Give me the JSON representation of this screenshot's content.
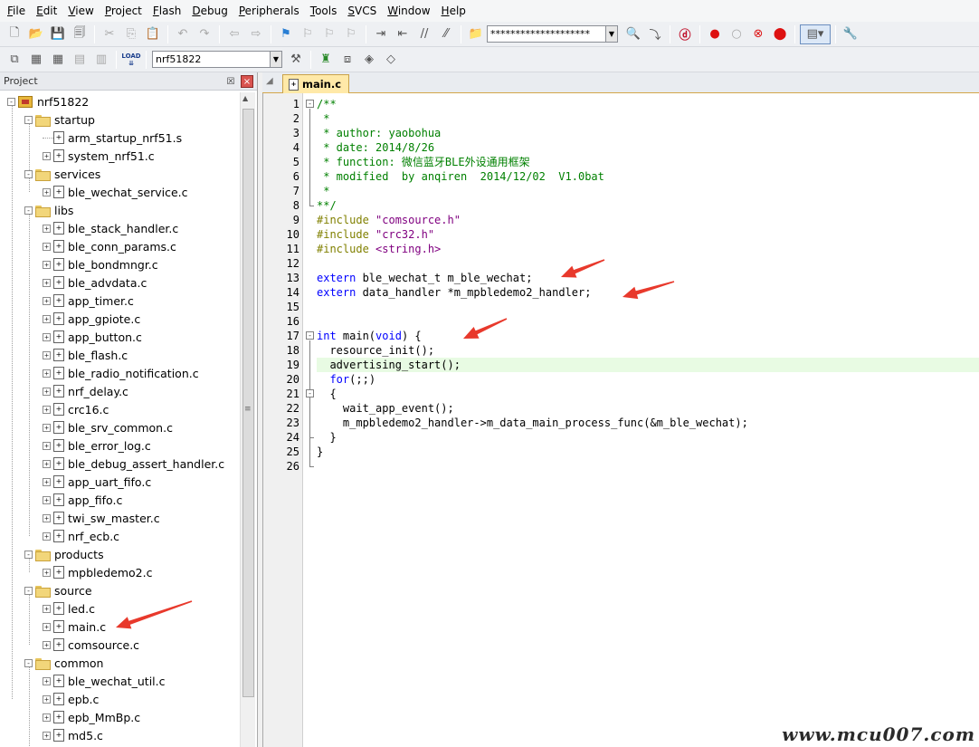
{
  "menubar": {
    "items": [
      {
        "label": "File",
        "key": "F",
        "rest": "ile"
      },
      {
        "label": "Edit",
        "key": "E",
        "rest": "dit"
      },
      {
        "label": "View",
        "key": "V",
        "rest": "iew"
      },
      {
        "label": "Project",
        "key": "P",
        "rest": "roject"
      },
      {
        "label": "Flash",
        "key": "F",
        "rest": "lash"
      },
      {
        "label": "Debug",
        "key": "D",
        "rest": "ebug"
      },
      {
        "label": "Peripherals",
        "key": "P",
        "rest": "eripherals"
      },
      {
        "label": "Tools",
        "key": "T",
        "rest": "ools"
      },
      {
        "label": "SVCS",
        "key": "S",
        "rest": "VCS"
      },
      {
        "label": "Window",
        "key": "W",
        "rest": "indow"
      },
      {
        "label": "Help",
        "key": "H",
        "rest": "elp"
      }
    ]
  },
  "toolbar": {
    "search_value": "********************",
    "target_value": "nrf51822",
    "build_icon_text": "LOAD"
  },
  "project_panel": {
    "title": "Project",
    "pin_glyph": "☒",
    "close_glyph": "×",
    "root": "nrf51822",
    "groups": [
      {
        "name": "startup",
        "files": [
          {
            "name": "arm_startup_nrf51.s",
            "expandable": false
          },
          {
            "name": "system_nrf51.c",
            "expandable": true
          }
        ]
      },
      {
        "name": "services",
        "files": [
          {
            "name": "ble_wechat_service.c",
            "expandable": true
          }
        ]
      },
      {
        "name": "libs",
        "files": [
          {
            "name": "ble_stack_handler.c",
            "expandable": true
          },
          {
            "name": "ble_conn_params.c",
            "expandable": true
          },
          {
            "name": "ble_bondmngr.c",
            "expandable": true
          },
          {
            "name": "ble_advdata.c",
            "expandable": true
          },
          {
            "name": "app_timer.c",
            "expandable": true
          },
          {
            "name": "app_gpiote.c",
            "expandable": true
          },
          {
            "name": "app_button.c",
            "expandable": true
          },
          {
            "name": "ble_flash.c",
            "expandable": true
          },
          {
            "name": "ble_radio_notification.c",
            "expandable": true
          },
          {
            "name": "nrf_delay.c",
            "expandable": true
          },
          {
            "name": "crc16.c",
            "expandable": true
          },
          {
            "name": "ble_srv_common.c",
            "expandable": true
          },
          {
            "name": "ble_error_log.c",
            "expandable": true
          },
          {
            "name": "ble_debug_assert_handler.c",
            "expandable": true
          },
          {
            "name": "app_uart_fifo.c",
            "expandable": true
          },
          {
            "name": "app_fifo.c",
            "expandable": true
          },
          {
            "name": "twi_sw_master.c",
            "expandable": true
          },
          {
            "name": "nrf_ecb.c",
            "expandable": true
          }
        ]
      },
      {
        "name": "products",
        "files": [
          {
            "name": "mpbledemo2.c",
            "expandable": true
          }
        ]
      },
      {
        "name": "source",
        "files": [
          {
            "name": "led.c",
            "expandable": true
          },
          {
            "name": "main.c",
            "expandable": true
          },
          {
            "name": "comsource.c",
            "expandable": true
          }
        ]
      },
      {
        "name": "common",
        "files": [
          {
            "name": "ble_wechat_util.c",
            "expandable": true
          },
          {
            "name": "epb.c",
            "expandable": true
          },
          {
            "name": "epb_MmBp.c",
            "expandable": true
          },
          {
            "name": "md5.c",
            "expandable": true
          }
        ]
      }
    ]
  },
  "editor": {
    "tab_label": "main.c",
    "lines": [
      {
        "n": "1",
        "tokens": [
          {
            "t": "/**",
            "c": "comment"
          }
        ]
      },
      {
        "n": "2",
        "tokens": [
          {
            "t": " *",
            "c": "comment"
          }
        ]
      },
      {
        "n": "3",
        "tokens": [
          {
            "t": " * author: yaobohua",
            "c": "comment"
          }
        ]
      },
      {
        "n": "4",
        "tokens": [
          {
            "t": " * date: 2014/8/26",
            "c": "comment"
          }
        ]
      },
      {
        "n": "5",
        "tokens": [
          {
            "t": " * function: 微信蓝牙BLE外设通用框架",
            "c": "comment"
          }
        ]
      },
      {
        "n": "6",
        "tokens": [
          {
            "t": " * modified  by anqiren  2014/12/02  V1.0bat",
            "c": "comment"
          }
        ]
      },
      {
        "n": "7",
        "tokens": [
          {
            "t": " *",
            "c": "comment"
          }
        ]
      },
      {
        "n": "8",
        "tokens": [
          {
            "t": "**/",
            "c": "comment"
          }
        ]
      },
      {
        "n": "9",
        "tokens": [
          {
            "t": "#include ",
            "c": "pp"
          },
          {
            "t": "\"comsource.h\"",
            "c": "str"
          }
        ]
      },
      {
        "n": "10",
        "tokens": [
          {
            "t": "#include ",
            "c": "pp"
          },
          {
            "t": "\"crc32.h\"",
            "c": "str"
          }
        ]
      },
      {
        "n": "11",
        "tokens": [
          {
            "t": "#include ",
            "c": "pp"
          },
          {
            "t": "<string.h>",
            "c": "str"
          }
        ]
      },
      {
        "n": "12",
        "tokens": []
      },
      {
        "n": "13",
        "tokens": [
          {
            "t": "extern",
            "c": "kw"
          },
          {
            "t": " ble_wechat_t m_ble_wechat;",
            "c": "id"
          }
        ]
      },
      {
        "n": "14",
        "tokens": [
          {
            "t": "extern",
            "c": "kw"
          },
          {
            "t": " data_handler *m_mpbledemo2_handler;",
            "c": "id"
          }
        ]
      },
      {
        "n": "15",
        "tokens": []
      },
      {
        "n": "16",
        "tokens": []
      },
      {
        "n": "17",
        "tokens": [
          {
            "t": "int",
            "c": "kw"
          },
          {
            "t": " main(",
            "c": "id"
          },
          {
            "t": "void",
            "c": "kw"
          },
          {
            "t": ") {",
            "c": "id"
          }
        ]
      },
      {
        "n": "18",
        "tokens": [
          {
            "t": "  resource_init();",
            "c": "id"
          }
        ]
      },
      {
        "n": "19",
        "tokens": [
          {
            "t": "  advertising_start();",
            "c": "id"
          }
        ],
        "highlight": true
      },
      {
        "n": "20",
        "tokens": [
          {
            "t": "  ",
            "c": "id"
          },
          {
            "t": "for",
            "c": "kw"
          },
          {
            "t": "(;;)",
            "c": "id"
          }
        ]
      },
      {
        "n": "21",
        "tokens": [
          {
            "t": "  {",
            "c": "id"
          }
        ]
      },
      {
        "n": "22",
        "tokens": [
          {
            "t": "    wait_app_event();",
            "c": "id"
          }
        ]
      },
      {
        "n": "23",
        "tokens": [
          {
            "t": "    m_mpbledemo2_handler->m_data_main_process_func(&m_ble_wechat);",
            "c": "id"
          }
        ]
      },
      {
        "n": "24",
        "tokens": [
          {
            "t": "  }",
            "c": "id"
          }
        ]
      },
      {
        "n": "25",
        "tokens": [
          {
            "t": "}",
            "c": "id"
          }
        ]
      },
      {
        "n": "26",
        "tokens": []
      }
    ]
  },
  "colors": {
    "comment": "#008000",
    "preprocessor": "#808000",
    "string": "#800080",
    "keyword": "#0000ff",
    "current_line": "#e8fbe3",
    "annotation_arrow": "#e8392c"
  },
  "watermark": "www.mcu007.com"
}
